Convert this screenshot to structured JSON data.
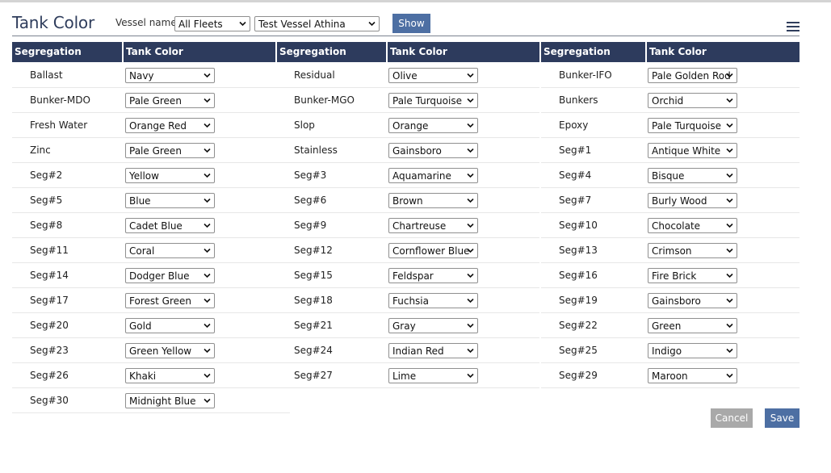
{
  "page": {
    "title": "Tank Color",
    "vessel_label": "Vessel name:",
    "fleet_value": "All Fleets",
    "vessel_value": "Test Vessel Athina",
    "show_label": "Show",
    "cancel_label": "Cancel",
    "save_label": "Save"
  },
  "headers": {
    "segregation": "Segregation",
    "tank_color": "Tank Color"
  },
  "columns": [
    [
      {
        "name": "Ballast",
        "color": "Navy"
      },
      {
        "name": "Bunker-MDO",
        "color": "Pale Green"
      },
      {
        "name": "Fresh Water",
        "color": "Orange Red"
      },
      {
        "name": "Zinc",
        "color": "Pale Green"
      },
      {
        "name": "Seg#2",
        "color": "Yellow"
      },
      {
        "name": "Seg#5",
        "color": "Blue"
      },
      {
        "name": "Seg#8",
        "color": "Cadet Blue"
      },
      {
        "name": "Seg#11",
        "color": "Coral"
      },
      {
        "name": "Seg#14",
        "color": "Dodger Blue"
      },
      {
        "name": "Seg#17",
        "color": "Forest Green"
      },
      {
        "name": "Seg#20",
        "color": "Gold"
      },
      {
        "name": "Seg#23",
        "color": "Green Yellow"
      },
      {
        "name": "Seg#26",
        "color": "Khaki"
      },
      {
        "name": "Seg#30",
        "color": "Midnight Blue"
      }
    ],
    [
      {
        "name": "Residual",
        "color": "Olive"
      },
      {
        "name": "Bunker-MGO",
        "color": "Pale Turquoise"
      },
      {
        "name": "Slop",
        "color": "Orange"
      },
      {
        "name": "Stainless",
        "color": "Gainsboro"
      },
      {
        "name": "Seg#3",
        "color": "Aquamarine"
      },
      {
        "name": "Seg#6",
        "color": "Brown"
      },
      {
        "name": "Seg#9",
        "color": "Chartreuse"
      },
      {
        "name": "Seg#12",
        "color": "Cornflower Blue"
      },
      {
        "name": "Seg#15",
        "color": "Feldspar"
      },
      {
        "name": "Seg#18",
        "color": "Fuchsia"
      },
      {
        "name": "Seg#21",
        "color": "Gray"
      },
      {
        "name": "Seg#24",
        "color": "Indian Red"
      },
      {
        "name": "Seg#27",
        "color": "Lime"
      }
    ],
    [
      {
        "name": "Bunker-IFO",
        "color": "Pale Golden Rod"
      },
      {
        "name": "Bunkers",
        "color": "Orchid"
      },
      {
        "name": "Epoxy",
        "color": "Pale Turquoise"
      },
      {
        "name": "Seg#1",
        "color": "Antique White"
      },
      {
        "name": "Seg#4",
        "color": "Bisque"
      },
      {
        "name": "Seg#7",
        "color": "Burly Wood"
      },
      {
        "name": "Seg#10",
        "color": "Chocolate"
      },
      {
        "name": "Seg#13",
        "color": "Crimson"
      },
      {
        "name": "Seg#16",
        "color": "Fire Brick"
      },
      {
        "name": "Seg#19",
        "color": "Gainsboro"
      },
      {
        "name": "Seg#22",
        "color": "Green"
      },
      {
        "name": "Seg#25",
        "color": "Indigo"
      },
      {
        "name": "Seg#29",
        "color": "Maroon"
      }
    ]
  ],
  "theme": {
    "header_bg": "#2d3b5d",
    "button_bg": "#4d6fa3",
    "cancel_bg": "#a9a9a9"
  },
  "icons": {
    "dropdown": "chevron-down-icon",
    "menu": "hamburger-menu-icon"
  }
}
